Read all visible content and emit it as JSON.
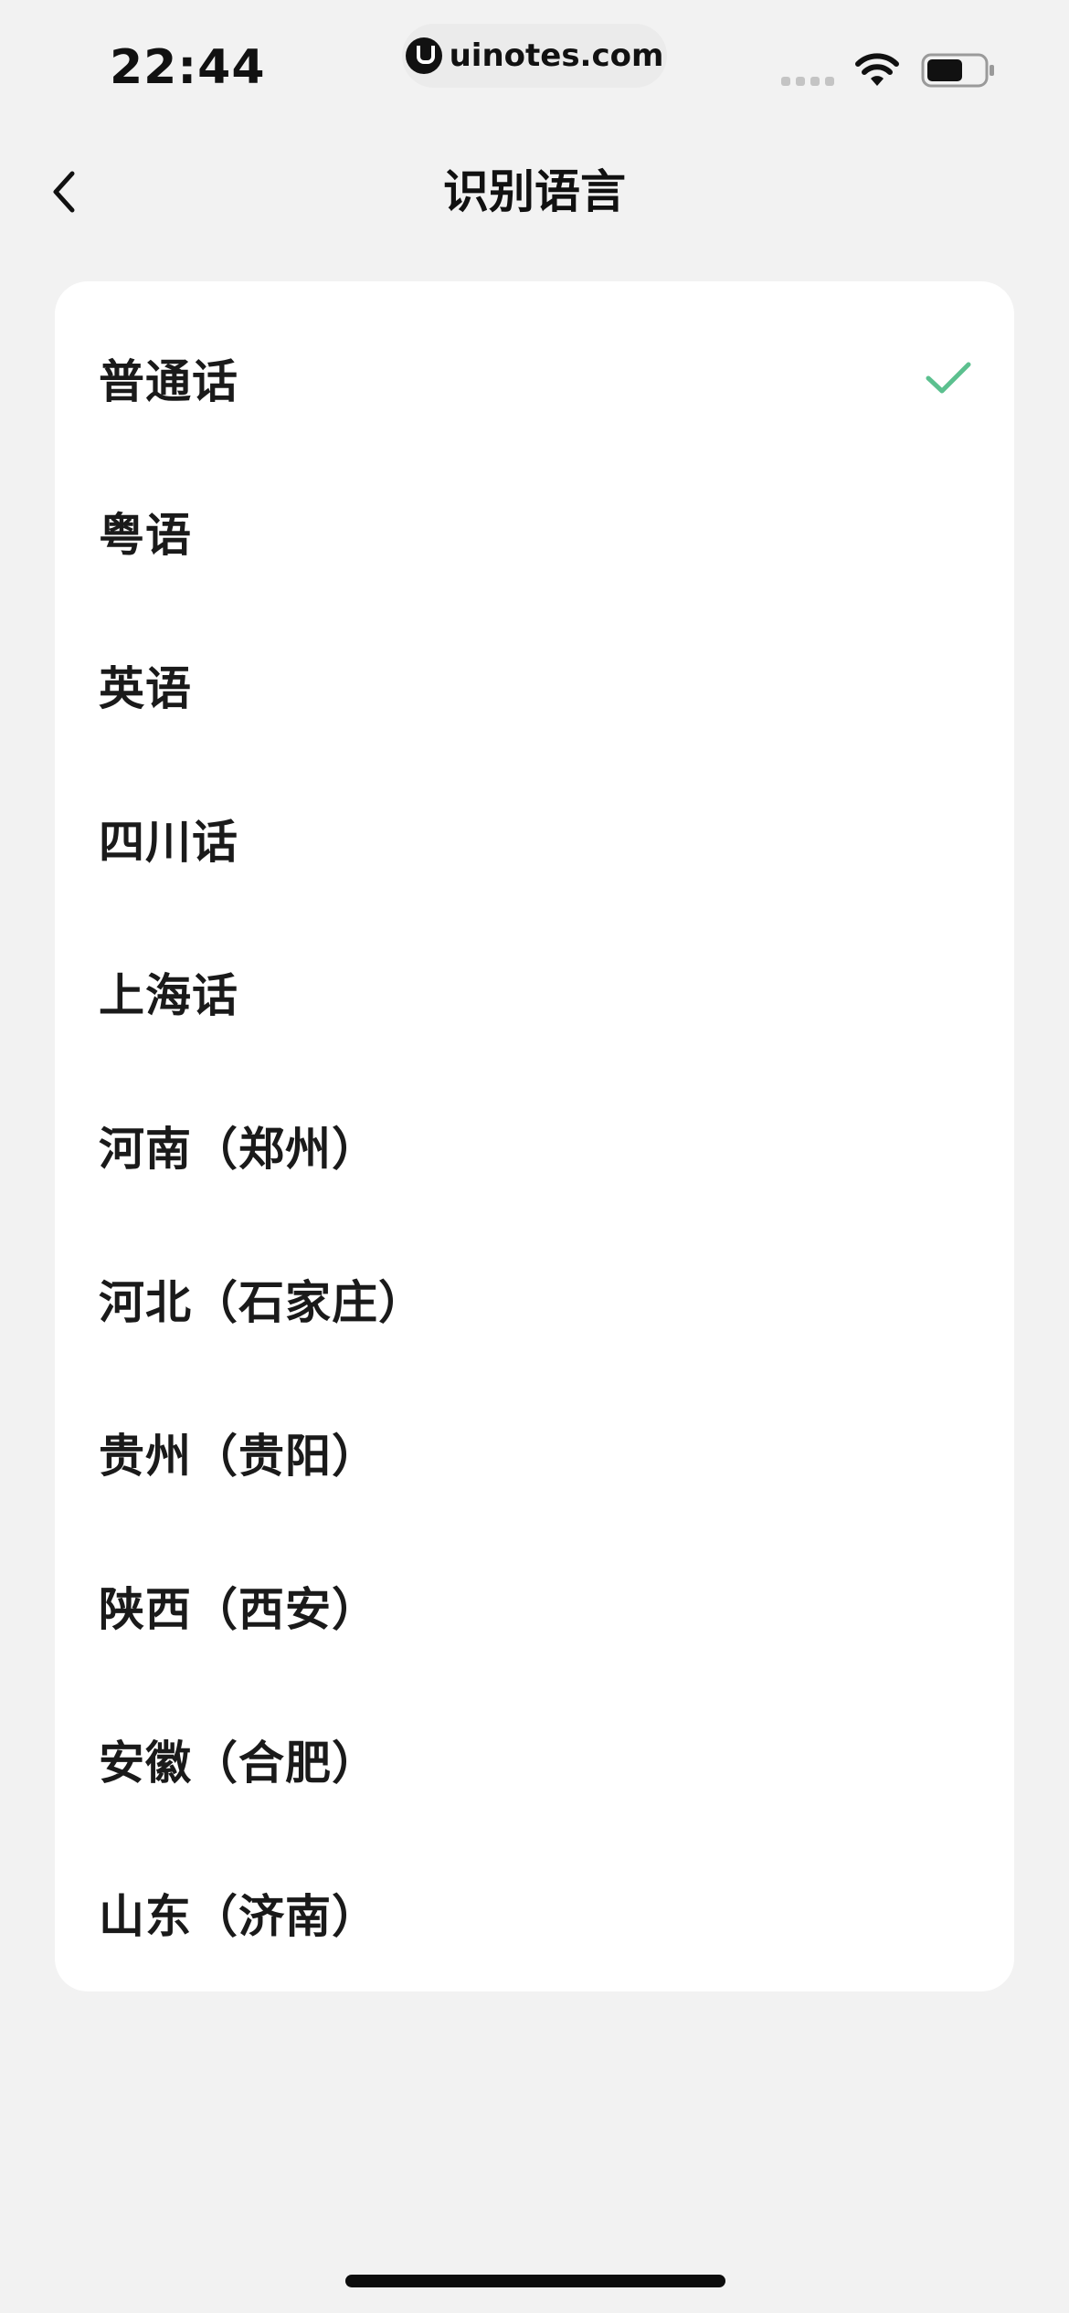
{
  "status_bar": {
    "time": "22:44",
    "watermark": "uinotes.com"
  },
  "header": {
    "title": "识别语言",
    "back_icon": "chevron-left-icon"
  },
  "languages": {
    "selected_index": 0,
    "accent_color": "#5cc08f",
    "items": [
      {
        "label": "普通话"
      },
      {
        "label": "粤语"
      },
      {
        "label": "英语"
      },
      {
        "label": "四川话"
      },
      {
        "label": "上海话"
      },
      {
        "label": "河南（郑州）"
      },
      {
        "label": "河北（石家庄）"
      },
      {
        "label": "贵州（贵阳）"
      },
      {
        "label": "陕西（西安）"
      },
      {
        "label": "安徽（合肥）"
      },
      {
        "label": "山东（济南）"
      }
    ]
  }
}
